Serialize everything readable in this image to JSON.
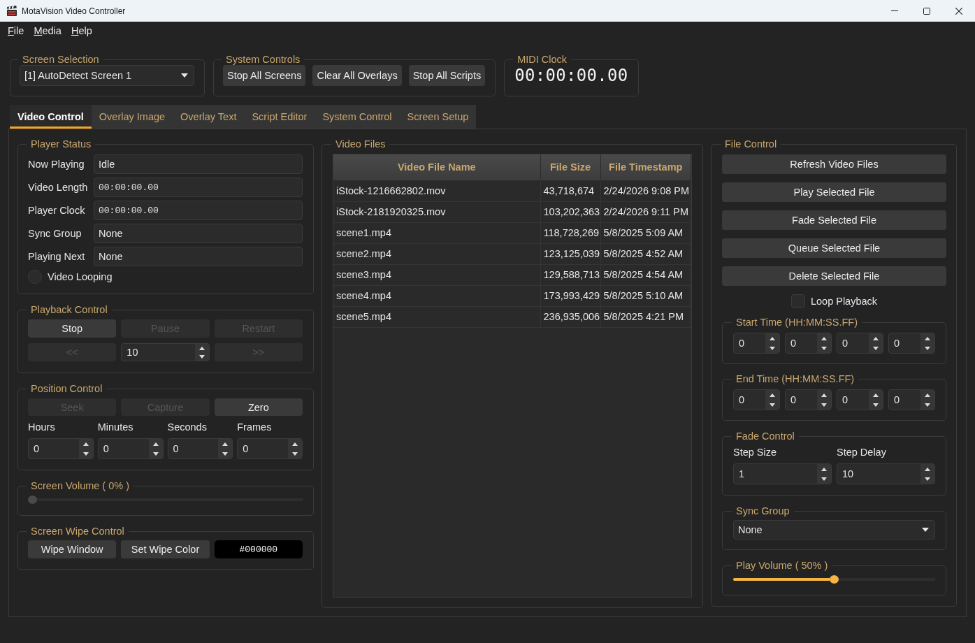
{
  "window": {
    "title": "MotaVision Video Controller"
  },
  "menu": [
    "File",
    "Media",
    "Help"
  ],
  "screen_selection": {
    "title": "Screen Selection",
    "value": "[1] AutoDetect Screen 1"
  },
  "system_controls": {
    "title": "System Controls",
    "buttons": [
      "Stop All Screens",
      "Clear All Overlays",
      "Stop All Scripts"
    ]
  },
  "midi_clock": {
    "title": "MIDI Clock",
    "value": "00:00:00.00"
  },
  "tabs": [
    {
      "label": "Video Control",
      "selected": true
    },
    {
      "label": "Overlay Image",
      "selected": false
    },
    {
      "label": "Overlay Text",
      "selected": false
    },
    {
      "label": "Script Editor",
      "selected": false
    },
    {
      "label": "System Control",
      "selected": false
    },
    {
      "label": "Screen Setup",
      "selected": false
    }
  ],
  "player_status": {
    "title": "Player Status",
    "fields": [
      {
        "label": "Now Playing",
        "value": "Idle",
        "kind": "text"
      },
      {
        "label": "Video Length",
        "value": "00:00:00.00",
        "kind": "time"
      },
      {
        "label": "Player Clock",
        "value": "00:00:00.00",
        "kind": "time"
      },
      {
        "label": "Sync Group",
        "value": "None",
        "kind": "text"
      },
      {
        "label": "Playing Next",
        "value": "None",
        "kind": "text"
      }
    ],
    "looping": {
      "label": "Video Looping",
      "checked": false
    }
  },
  "playback_control": {
    "title": "Playback Control",
    "buttons": [
      {
        "label": "Stop",
        "disabled": false
      },
      {
        "label": "Pause",
        "disabled": true
      },
      {
        "label": "Restart",
        "disabled": true
      }
    ],
    "step_row": [
      {
        "kind": "button",
        "label": "<<",
        "disabled": true
      },
      {
        "kind": "spin",
        "value": "10",
        "disabled": false
      },
      {
        "kind": "button",
        "label": ">>",
        "disabled": true
      }
    ]
  },
  "position_control": {
    "title": "Position Control",
    "buttons": [
      {
        "label": "Seek",
        "disabled": true
      },
      {
        "label": "Capture",
        "disabled": true
      },
      {
        "label": "Zero",
        "disabled": false
      }
    ],
    "fields": [
      {
        "label": "Hours",
        "value": "0"
      },
      {
        "label": "Minutes",
        "value": "0"
      },
      {
        "label": "Seconds",
        "value": "0"
      },
      {
        "label": "Frames",
        "value": "0"
      }
    ]
  },
  "screen_volume": {
    "title": "Screen Volume ( 0% )",
    "level": 0,
    "disabled": true
  },
  "screen_wipe": {
    "title": "Screen Wipe Control",
    "buttons": [
      "Wipe Window",
      "Set Wipe Color"
    ],
    "color_field": {
      "value": "#000000",
      "color": "#000000"
    }
  },
  "video_files": {
    "title": "Video Files",
    "columns": [
      "Video File Name",
      "File Size",
      "File Timestamp"
    ],
    "rows": [
      [
        "iStock-1216662802.mov",
        "43,718,674",
        "2/24/2026 9:08 PM"
      ],
      [
        "iStock-2181920325.mov",
        "103,202,363",
        "2/24/2026 9:11 PM"
      ],
      [
        "scene1.mp4",
        "118,728,269",
        "5/8/2025 5:09 AM"
      ],
      [
        "scene2.mp4",
        "123,125,039",
        "5/8/2025 4:52 AM"
      ],
      [
        "scene3.mp4",
        "129,588,713",
        "5/8/2025 4:54 AM"
      ],
      [
        "scene4.mp4",
        "173,993,429",
        "5/8/2025 5:10 AM"
      ],
      [
        "scene5.mp4",
        "236,935,006",
        "5/8/2025 4:21 PM"
      ]
    ]
  },
  "file_control": {
    "title": "File Control",
    "buttons": [
      "Refresh Video Files",
      "Play Selected File",
      "Fade Selected File",
      "Queue Selected File",
      "Delete Selected File"
    ],
    "loop_playback": {
      "label": "Loop Playback",
      "checked": false
    },
    "start_time": {
      "title": "Start Time (HH:MM:SS.FF)",
      "values": [
        "0",
        "0",
        "0",
        "0"
      ]
    },
    "end_time": {
      "title": "End Time (HH:MM:SS.FF)",
      "values": [
        "0",
        "0",
        "0",
        "0"
      ]
    },
    "fade_control": {
      "title": "Fade Control",
      "fields": [
        {
          "label": "Step Size",
          "value": "1"
        },
        {
          "label": "Step Delay",
          "value": "10"
        }
      ]
    },
    "sync_group": {
      "title": "Sync Group",
      "value": "None"
    },
    "play_volume": {
      "title": "Play Volume ( 50% )",
      "level": 0.5
    }
  }
}
